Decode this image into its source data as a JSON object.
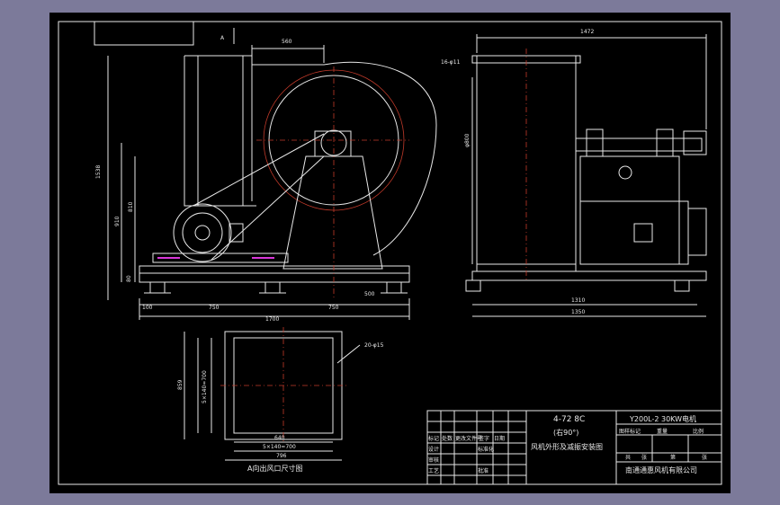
{
  "dimensions": {
    "top_width": "560",
    "overall_height": "1538",
    "height_910": "910",
    "height_810": "810",
    "base_offset": "80",
    "base_100": "100",
    "base_750_left": "750",
    "base_750_right": "750",
    "base_500": "500",
    "base_1700": "1700",
    "side_width": "1472",
    "side_bolts": "16-φ11",
    "side_height": "φ800",
    "side_1310": "1310",
    "side_1350": "1350",
    "outlet_holes": "20-φ15",
    "outlet_height_outer": "859",
    "outlet_height_pitch": "5×140=700",
    "outlet_width_inner": "640",
    "outlet_width_pitch": "5×140=700",
    "outlet_width_outer": "796",
    "view_marker": "A"
  },
  "outlet_caption": "A向出风口尺寸图",
  "title_block": {
    "model": "4-72 8C",
    "rotation": "(右90°)",
    "drawing_name": "风机外形及减振安装图",
    "motor": "Y200L-2 30KW电机",
    "company": "南通通惠风机有限公司",
    "fields": [
      "图样标记",
      "重量",
      "比例",
      "共",
      "张",
      "第",
      "张"
    ],
    "left_labels": [
      "标记",
      "处数",
      "更改文件号",
      "签字",
      "日期",
      "设计",
      "标准化",
      "审核",
      "工艺",
      "批准"
    ]
  }
}
